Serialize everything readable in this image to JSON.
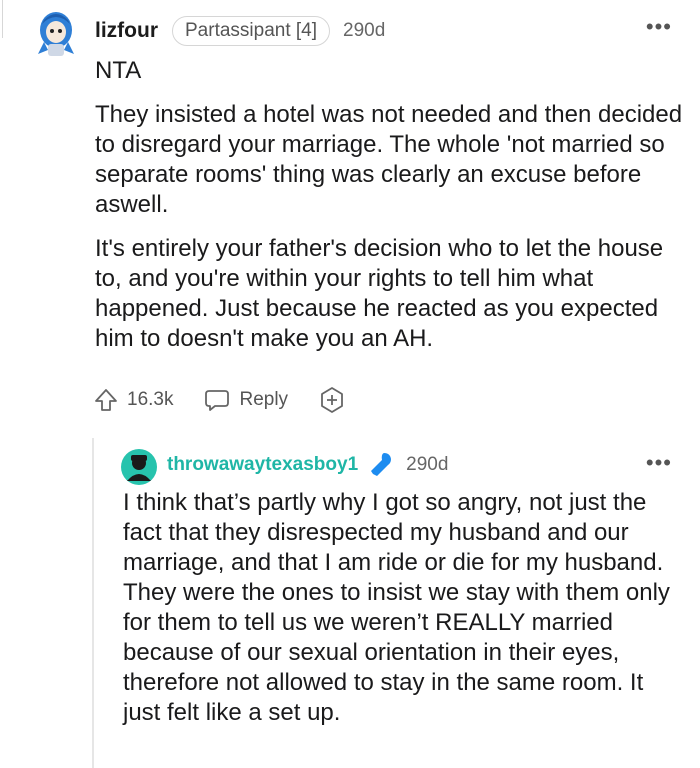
{
  "comment": {
    "username": "lizfour",
    "flair": "Partassipant [4]",
    "age": "290d",
    "more_icon": "more-horizontal-icon",
    "paragraphs": [
      "NTA",
      "They insisted a hotel was not needed and then decided to disregard your marriage. The whole 'not married so separate rooms' thing was clearly an excuse before aswell.",
      "It's entirely your father's decision who to let the house to, and you're within your rights to tell him what happened. Just because he reacted as you expected him to doesn't make you an AH."
    ],
    "votes": "16.3k",
    "reply_label": "Reply"
  },
  "reply": {
    "username": "throwawaytexasboy1",
    "age": "290d",
    "text": "I think that’s partly why I got so angry, not just the fact that they disrespected my husband and our marriage, and that I am ride or die for my husband. They were the ones to insist we stay with them only for them to tell us we weren’t REALLY married because of our sexual orientation in their eyes, therefore not allowed to stay in the same room. It just felt like a set up."
  },
  "colors": {
    "reply_username": "#1fb6a6",
    "mic": "#1d8cf0"
  }
}
